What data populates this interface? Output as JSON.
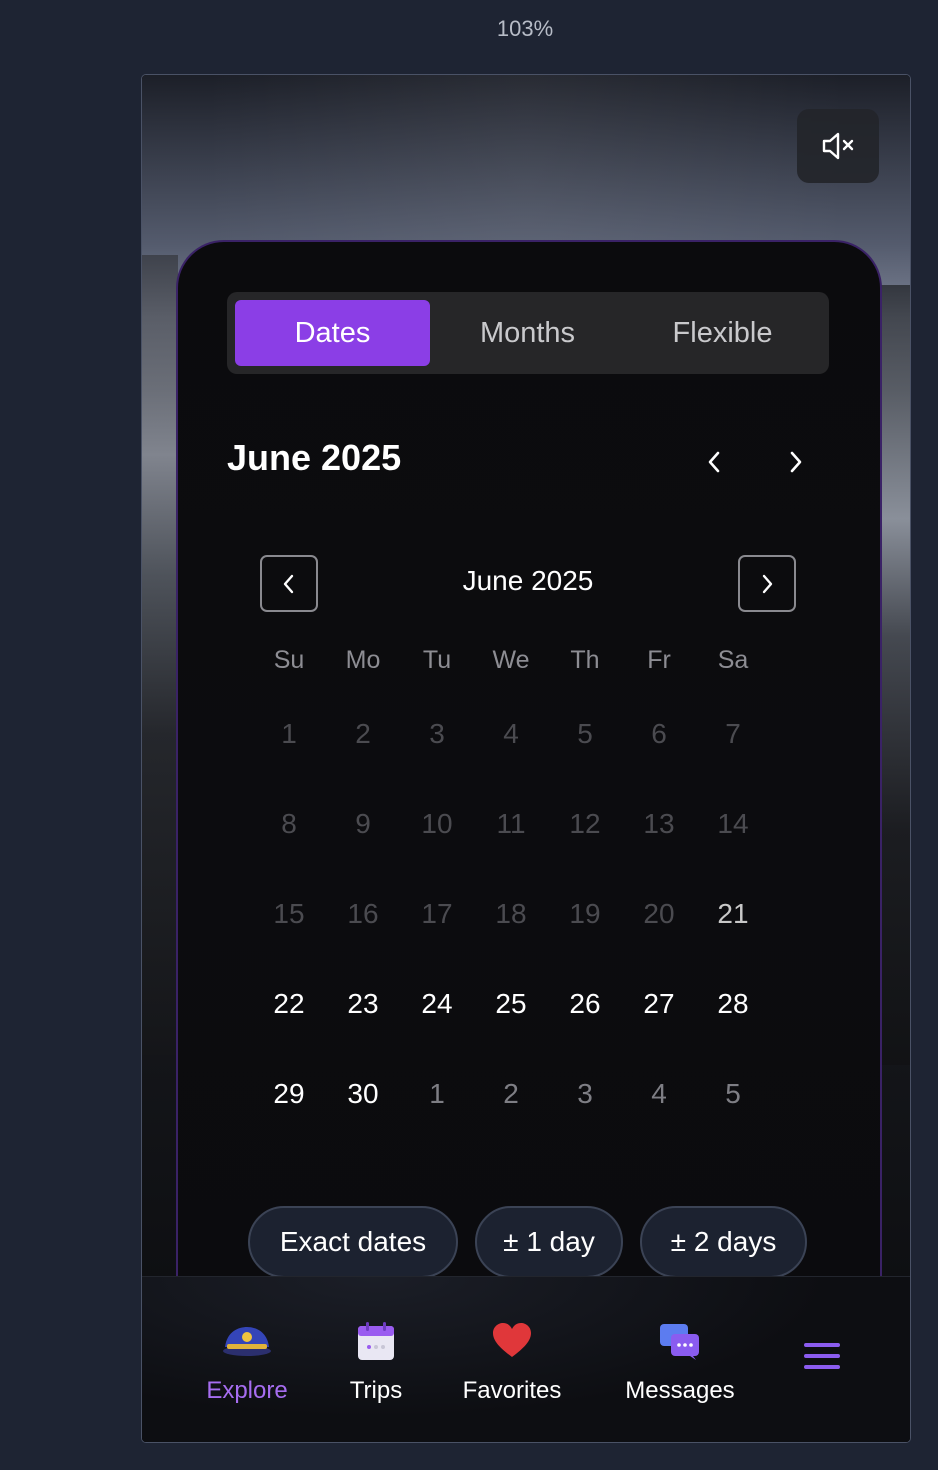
{
  "zoom": "103%",
  "segment": {
    "tabs": [
      "Dates",
      "Months",
      "Flexible"
    ],
    "active": 0
  },
  "month_header": "June 2025",
  "calendar": {
    "title": "June 2025",
    "weekdays": [
      "Su",
      "Mo",
      "Tu",
      "We",
      "Th",
      "Fr",
      "Sa"
    ],
    "weeks": [
      [
        "1",
        "2",
        "3",
        "4",
        "5",
        "6",
        "7"
      ],
      [
        "8",
        "9",
        "10",
        "11",
        "12",
        "13",
        "14"
      ],
      [
        "15",
        "16",
        "17",
        "18",
        "19",
        "20",
        "21"
      ],
      [
        "22",
        "23",
        "24",
        "25",
        "26",
        "27",
        "28"
      ],
      [
        "29",
        "30",
        "1",
        "2",
        "3",
        "4",
        "5"
      ]
    ],
    "today": "21"
  },
  "flex_chips": [
    "Exact dates",
    "± 1 day",
    "± 2 days"
  ],
  "tabbar": {
    "items": [
      {
        "label": "Explore",
        "icon": "captain-hat-icon"
      },
      {
        "label": "Trips",
        "icon": "calendar-icon"
      },
      {
        "label": "Favorites",
        "icon": "heart-icon"
      },
      {
        "label": "Messages",
        "icon": "chat-bubbles-icon"
      }
    ],
    "menu_icon": "hamburger-menu-icon",
    "active_color": "#a66df0"
  },
  "colors": {
    "accent": "#8b3ee6",
    "sheet_border": "#3a2266"
  }
}
